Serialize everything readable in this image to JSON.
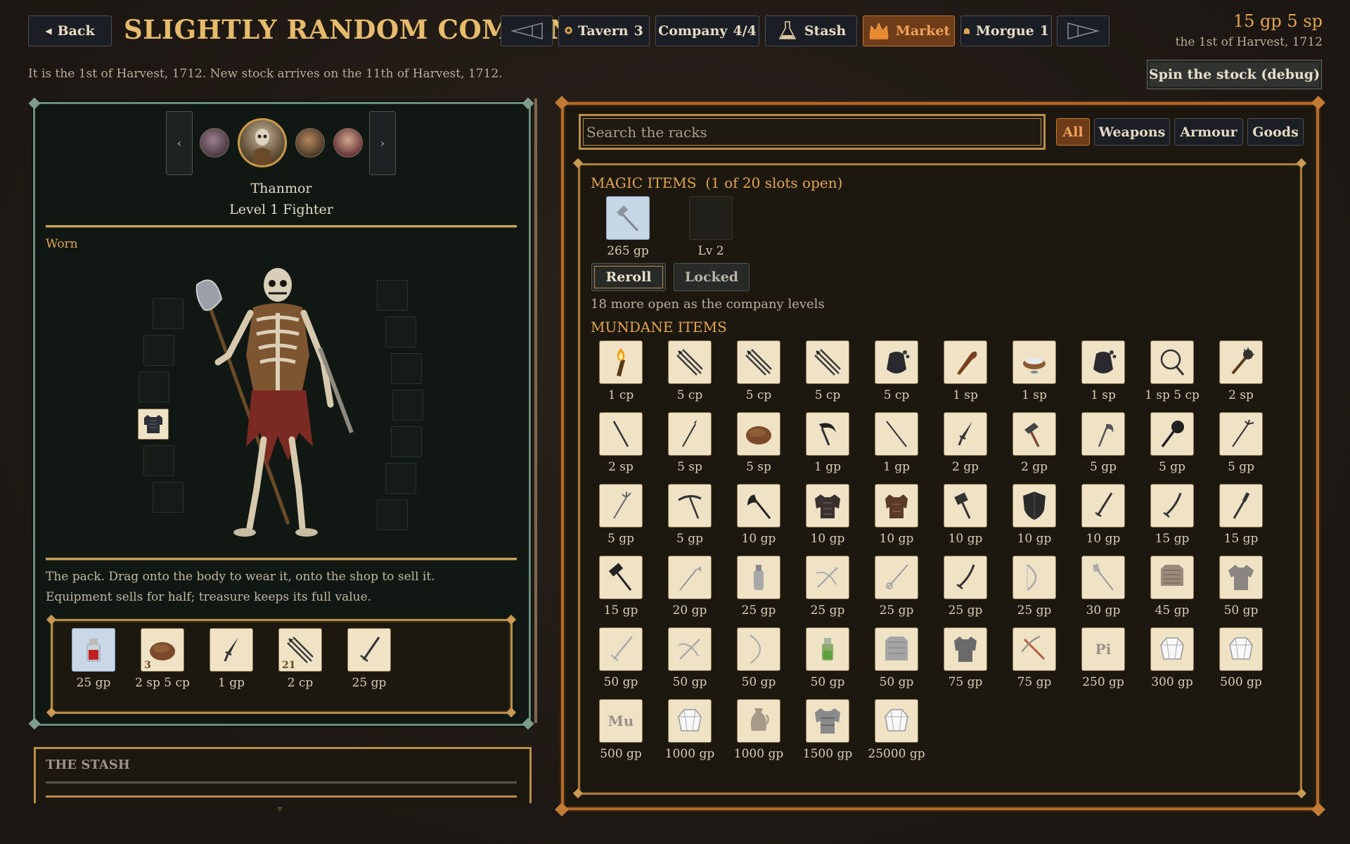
{
  "header": {
    "back_label": "Back",
    "title": "SLIGHTLY RANDOM COMPANY",
    "money": "15 gp 5 sp",
    "date": "the 1st of Harvest, 1712"
  },
  "nav": {
    "tavern": {
      "label": "Tavern",
      "count": "3"
    },
    "company": {
      "label": "Company",
      "count": "4/4"
    },
    "stash": {
      "label": "Stash"
    },
    "market": {
      "label": "Market"
    },
    "morgue": {
      "label": "Morgue",
      "count": "1"
    }
  },
  "info_line": "It is the 1st of Harvest, 1712. New stock arrives on the 11th of Harvest, 1712.",
  "debug_label": "Spin the stock (debug)",
  "character": {
    "name": "Thanmor",
    "class": "Level 1 Fighter",
    "prev_label": "‹",
    "next_label": "›"
  },
  "worn_label": "Worn",
  "pack_text_1": "The pack. Drag onto the body to wear it, onto the shop to sell it.",
  "pack_text_2": "Equipment sells for half; treasure keeps its full value.",
  "pack": [
    {
      "icon": "potion-icon",
      "price": "25 gp",
      "qty": ""
    },
    {
      "icon": "bread-icon",
      "price": "2 sp 5 cp",
      "qty": "3"
    },
    {
      "icon": "dagger-icon",
      "price": "1 gp",
      "qty": ""
    },
    {
      "icon": "arrows-icon",
      "price": "2 cp",
      "qty": "21"
    },
    {
      "icon": "sword-icon",
      "price": "25 gp",
      "qty": ""
    }
  ],
  "stash_title": "THE STASH",
  "search": {
    "placeholder": "Search the racks"
  },
  "filters": {
    "all": "All",
    "weapons": "Weapons",
    "armour": "Armour",
    "goods": "Goods"
  },
  "magic": {
    "title": "MAGIC ITEMS",
    "slots": "(1 of 20 slots open)",
    "item_price": "265 gp",
    "locked_level": "Lv 2",
    "reroll_label": "Reroll",
    "locked_label": "Locked",
    "note": "18 more open as the company levels"
  },
  "mundane": {
    "title": "MUNDANE ITEMS",
    "items": [
      {
        "icon": "torch-icon",
        "price": "1 cp"
      },
      {
        "icon": "arrows-icon",
        "price": "5 cp"
      },
      {
        "icon": "arrows-icon",
        "price": "5 cp"
      },
      {
        "icon": "arrows-icon",
        "price": "5 cp"
      },
      {
        "icon": "pouch-icon",
        "price": "5 cp"
      },
      {
        "icon": "club-icon",
        "price": "1 sp"
      },
      {
        "icon": "rations-icon",
        "price": "1 sp"
      },
      {
        "icon": "pouch-icon",
        "price": "1 sp"
      },
      {
        "icon": "net-icon",
        "price": "1 sp 5 cp"
      },
      {
        "icon": "morningstar-icon",
        "price": "2 sp"
      },
      {
        "icon": "staff-icon",
        "price": "2 sp"
      },
      {
        "icon": "javelin-icon",
        "price": "5 sp"
      },
      {
        "icon": "bread-icon",
        "price": "5 sp"
      },
      {
        "icon": "sickle-icon",
        "price": "1 gp"
      },
      {
        "icon": "spear-icon",
        "price": "1 gp"
      },
      {
        "icon": "dagger-icon",
        "price": "2 gp"
      },
      {
        "icon": "hammer-icon",
        "price": "2 gp"
      },
      {
        "icon": "handaxe-icon",
        "price": "5 gp"
      },
      {
        "icon": "mace-icon",
        "price": "5 gp"
      },
      {
        "icon": "trident-icon",
        "price": "5 gp"
      },
      {
        "icon": "pitchfork-icon",
        "price": "5 gp"
      },
      {
        "icon": "pick-icon",
        "price": "5 gp"
      },
      {
        "icon": "battleaxe-icon",
        "price": "10 gp"
      },
      {
        "icon": "leather-armor-icon",
        "price": "10 gp"
      },
      {
        "icon": "hide-armor-icon",
        "price": "10 gp"
      },
      {
        "icon": "warhammer-icon",
        "price": "10 gp"
      },
      {
        "icon": "shield-icon",
        "price": "10 gp"
      },
      {
        "icon": "shortsword-icon",
        "price": "10 gp"
      },
      {
        "icon": "scimitar-icon",
        "price": "15 gp"
      },
      {
        "icon": "flail-icon",
        "price": "15 gp"
      },
      {
        "icon": "maul-icon",
        "price": "15 gp"
      },
      {
        "icon": "glaive-icon",
        "price": "20 gp"
      },
      {
        "icon": "bottle-icon",
        "price": "25 gp"
      },
      {
        "icon": "crossbow-icon",
        "price": "25 gp"
      },
      {
        "icon": "rapier-icon",
        "price": "25 gp"
      },
      {
        "icon": "scimitar-icon",
        "price": "25 gp"
      },
      {
        "icon": "bow-icon",
        "price": "25 gp"
      },
      {
        "icon": "halberd-icon",
        "price": "30 gp"
      },
      {
        "icon": "scale-armor-icon",
        "price": "45 gp"
      },
      {
        "icon": "shirt-icon",
        "price": "50 gp"
      },
      {
        "icon": "longsword-icon",
        "price": "50 gp"
      },
      {
        "icon": "crossbow-icon",
        "price": "50 gp"
      },
      {
        "icon": "longbow-icon",
        "price": "50 gp"
      },
      {
        "icon": "green-potion-icon",
        "price": "50 gp"
      },
      {
        "icon": "chain-shirt-icon",
        "price": "50 gp"
      },
      {
        "icon": "breastplate-icon",
        "price": "75 gp"
      },
      {
        "icon": "heavy-crossbow-icon",
        "price": "75 gp"
      },
      {
        "icon": "text-icon",
        "label": "Pi",
        "price": "250 gp"
      },
      {
        "icon": "gem-icon",
        "price": "300 gp"
      },
      {
        "icon": "gem-icon",
        "price": "500 gp"
      },
      {
        "icon": "text-icon",
        "label": "Mu",
        "price": "500 gp"
      },
      {
        "icon": "gem-icon",
        "price": "1000 gp"
      },
      {
        "icon": "jug-icon",
        "price": "1000 gp"
      },
      {
        "icon": "plate-armor-icon",
        "price": "1500 gp"
      },
      {
        "icon": "gem-icon",
        "price": "25000 gp"
      }
    ]
  },
  "colors": {
    "accent": "#e6bc6c",
    "market_active": "#f0a15a",
    "panel_left_border": "#6d8c7c",
    "panel_right_border": "#b06a2a"
  }
}
